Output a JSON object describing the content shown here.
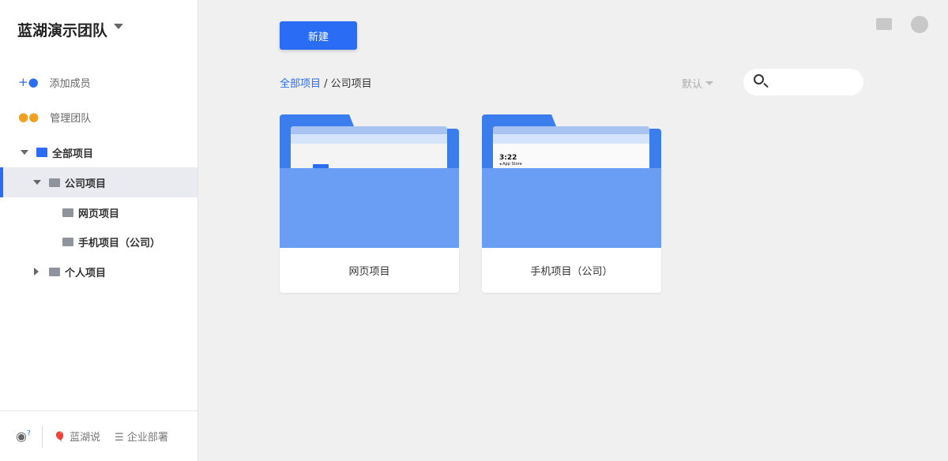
{
  "sidebar": {
    "team": "蓝湖演示团队",
    "add_member": "添加成员",
    "manage_team": "管理团队",
    "tree": {
      "all": "全部项目",
      "company": "公司项目",
      "web": "网页项目",
      "mobile": "手机项目（公司）",
      "personal": "个人项目"
    },
    "footer": {
      "lanhu_say": "蓝湖说",
      "enterprise": "企业部署"
    }
  },
  "main": {
    "new_button": "新建",
    "breadcrumb": {
      "root": "全部项目",
      "sep": " / ",
      "current": "公司项目"
    },
    "sort": "默认",
    "cards": [
      {
        "name": "网页项目"
      },
      {
        "name": "手机项目（公司）",
        "preview_time": "3:22",
        "preview_back": "◂ App Store"
      }
    ]
  },
  "colors": {
    "accent": "#2a6df4",
    "folder": "#3b7ded",
    "folder_front": "#6a9ef4"
  }
}
